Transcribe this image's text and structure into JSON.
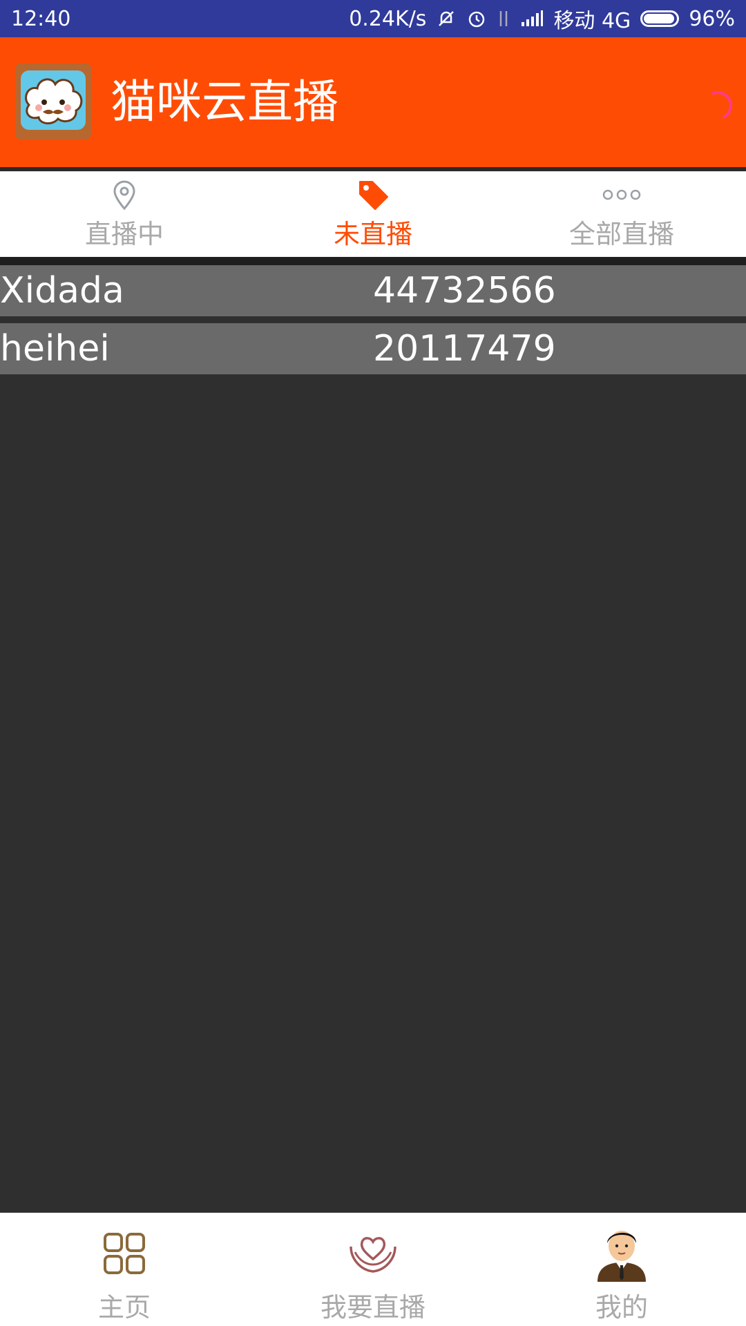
{
  "status_bar": {
    "time": "12:40",
    "net_speed": "0.24K/s",
    "carrier": "移动 4G",
    "battery": "96%",
    "battery_level": 0.96
  },
  "app_bar": {
    "title": "猫咪云直播"
  },
  "tabs": [
    {
      "label": "直播中",
      "icon": "location-pin-icon",
      "active": false
    },
    {
      "label": "未直播",
      "icon": "tag-icon",
      "active": true
    },
    {
      "label": "全部直播",
      "icon": "more-dots-icon",
      "active": false
    }
  ],
  "list": [
    {
      "name": "Xidada",
      "id": "44732566"
    },
    {
      "name": "heihei",
      "id": "20117479"
    }
  ],
  "bottom_nav": [
    {
      "label": "主页",
      "icon": "grid-home-icon"
    },
    {
      "label": "我要直播",
      "icon": "heart-hands-icon"
    },
    {
      "label": "我的",
      "icon": "user-avatar-icon"
    }
  ],
  "colors": {
    "status_bar": "#2f3a9a",
    "accent": "#ff4c05",
    "row_bg": "#6a6a6a",
    "page_bg": "#2f2f2f",
    "inactive": "#a9a9a9"
  }
}
